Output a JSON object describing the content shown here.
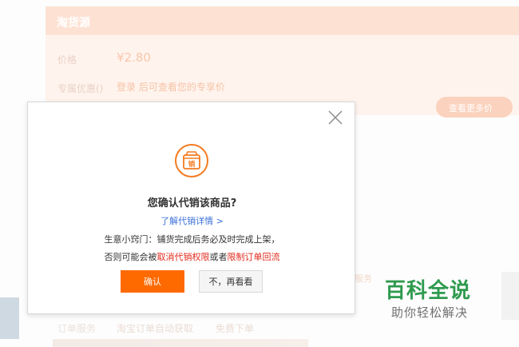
{
  "background": {
    "header_title": "淘货源",
    "price_label": "价格",
    "price_value": "¥2.80",
    "coupon_label": "专属优惠()",
    "coupon_text": "登录 后可查看您的专享价",
    "pill_label": "查看更多价 >",
    "order_label": "订单服务",
    "order_opt1": "淘宝订单自动获取",
    "order_opt2": "免费下单",
    "side_text": "服务"
  },
  "modal": {
    "title": "您确认代销该商品?",
    "link_text": "了解代销详情 >",
    "tip_line1": "生意小窍门：铺货完成后务必及时完成上架，",
    "tip_line2_prefix": "否则可能会被",
    "tip_line2_red1": "取消代销权限",
    "tip_line2_mid": "或者",
    "tip_line2_red2": "限制订单回流",
    "confirm_label": "确认",
    "cancel_label": "不，再看看",
    "icon_char": "销"
  },
  "watermark": {
    "main": "百科全说",
    "sub": "助你轻松解决"
  },
  "colors": {
    "accent": "#ff6a00",
    "link": "#3a6fd8",
    "warning_red": "#e4291c",
    "watermark_green": "#2e9a4e"
  }
}
